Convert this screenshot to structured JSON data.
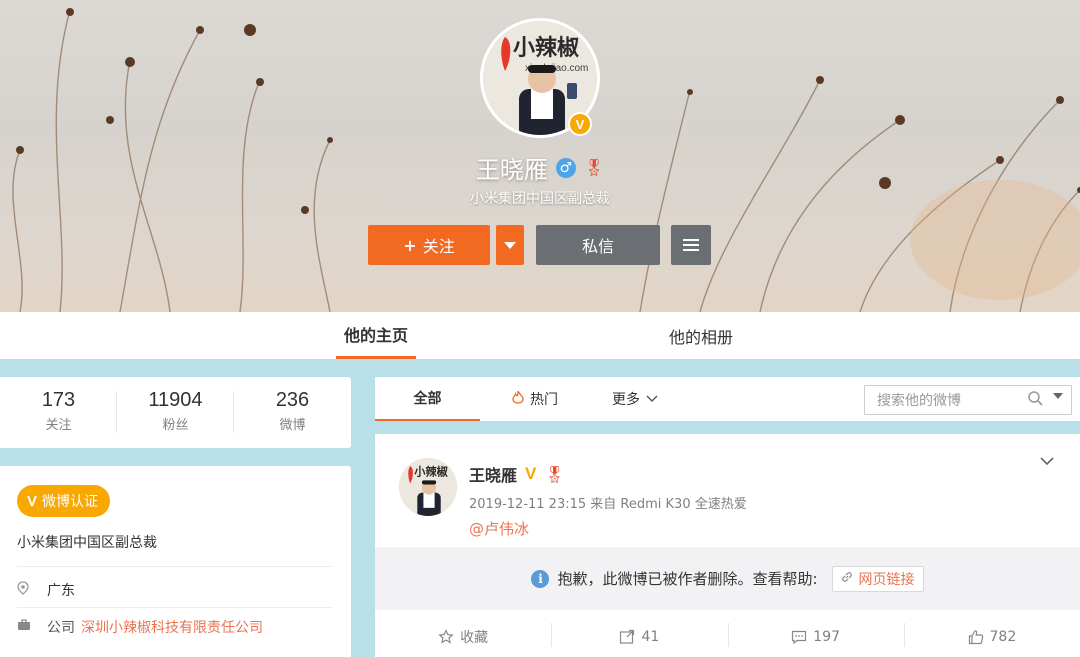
{
  "profile": {
    "name": "王晓雁",
    "title": "小米集团中国区副总裁",
    "verified_badge": "V",
    "gender_icon": "male-icon",
    "medal_icon": "medal-icon"
  },
  "actions": {
    "follow_label": "关注",
    "follow_plus": "+",
    "message_label": "私信"
  },
  "tabs": [
    {
      "label": "他的主页",
      "active": true
    },
    {
      "label": "他的相册",
      "active": false
    }
  ],
  "stats": [
    {
      "value": "173",
      "label": "关注"
    },
    {
      "value": "11904",
      "label": "粉丝"
    },
    {
      "value": "236",
      "label": "微博"
    }
  ],
  "info": {
    "verify_tag": "微博认证",
    "verify_v": "V",
    "verify_title": "小米集团中国区副总裁",
    "location": "广东",
    "company_label": "公司",
    "company_name": "深圳小辣椒科技有限责任公司"
  },
  "feed": {
    "tab_all": "全部",
    "tab_hot": "热门",
    "tab_more": "更多",
    "search_placeholder": "搜索他的微博"
  },
  "post": {
    "author": "王晓雁",
    "verified": "V",
    "meta": "2019-12-11 23:15 来自 Redmi K30 全速热爱",
    "mention": "@卢伟冰",
    "deleted_text": "抱歉，此微博已被作者删除。查看帮助:",
    "link_label": "网页链接",
    "favorite_label": "收藏",
    "repost_count": "41",
    "comment_count": "197",
    "like_count": "782"
  },
  "avatar_logo": {
    "brand_text": "小辣椒",
    "domain_text": "xiaolajiao.com"
  },
  "colors": {
    "accent": "#f26a22",
    "verified": "#f8a800",
    "link": "#eb7350",
    "page_bg": "#b9dfe8"
  }
}
